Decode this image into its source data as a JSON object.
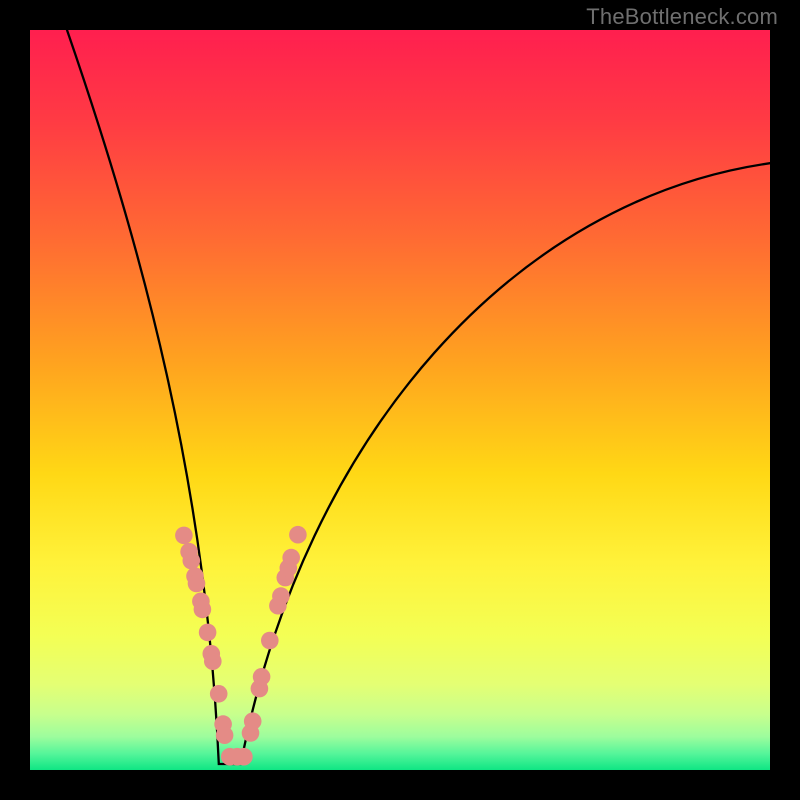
{
  "watermark": "TheBottleneck.com",
  "colors": {
    "frame": "#000000",
    "curve": "#000000",
    "dot_fill": "#e48b86",
    "dot_stroke": "#d9736e"
  },
  "chart_data": {
    "type": "line",
    "title": "",
    "xlabel": "",
    "ylabel": "",
    "xlim": [
      0,
      740
    ],
    "ylim": [
      0,
      740
    ],
    "curve": {
      "description": "V-shaped bottleneck curve (percent bottleneck vs component balance). Minimum near x≈0.27 of width. Left branch steep, right branch shallow asymptotic.",
      "min_x_frac": 0.27,
      "left_top_x_frac": 0.05,
      "right_end_y_frac": 0.82
    },
    "series": [
      {
        "name": "highlighted-points",
        "points_frac": [
          [
            0.208,
            0.317
          ],
          [
            0.215,
            0.295
          ],
          [
            0.218,
            0.283
          ],
          [
            0.223,
            0.262
          ],
          [
            0.225,
            0.252
          ],
          [
            0.231,
            0.228
          ],
          [
            0.233,
            0.217
          ],
          [
            0.24,
            0.186
          ],
          [
            0.245,
            0.157
          ],
          [
            0.247,
            0.147
          ],
          [
            0.255,
            0.103
          ],
          [
            0.261,
            0.062
          ],
          [
            0.263,
            0.047
          ],
          [
            0.27,
            0.018
          ],
          [
            0.28,
            0.018
          ],
          [
            0.289,
            0.018
          ],
          [
            0.298,
            0.05
          ],
          [
            0.301,
            0.066
          ],
          [
            0.31,
            0.11
          ],
          [
            0.313,
            0.126
          ],
          [
            0.324,
            0.175
          ],
          [
            0.335,
            0.222
          ],
          [
            0.339,
            0.235
          ],
          [
            0.345,
            0.26
          ],
          [
            0.349,
            0.273
          ],
          [
            0.353,
            0.287
          ],
          [
            0.362,
            0.318
          ]
        ]
      }
    ],
    "gradient_stops": [
      {
        "offset": 0.0,
        "color": "#ff1f4f"
      },
      {
        "offset": 0.12,
        "color": "#ff3a44"
      },
      {
        "offset": 0.28,
        "color": "#ff6a33"
      },
      {
        "offset": 0.45,
        "color": "#ffa31f"
      },
      {
        "offset": 0.6,
        "color": "#ffd815"
      },
      {
        "offset": 0.72,
        "color": "#fff23a"
      },
      {
        "offset": 0.82,
        "color": "#f3ff55"
      },
      {
        "offset": 0.885,
        "color": "#e4ff74"
      },
      {
        "offset": 0.925,
        "color": "#c7ff8d"
      },
      {
        "offset": 0.955,
        "color": "#9dfd9d"
      },
      {
        "offset": 0.978,
        "color": "#55f59a"
      },
      {
        "offset": 1.0,
        "color": "#0fe684"
      }
    ]
  }
}
